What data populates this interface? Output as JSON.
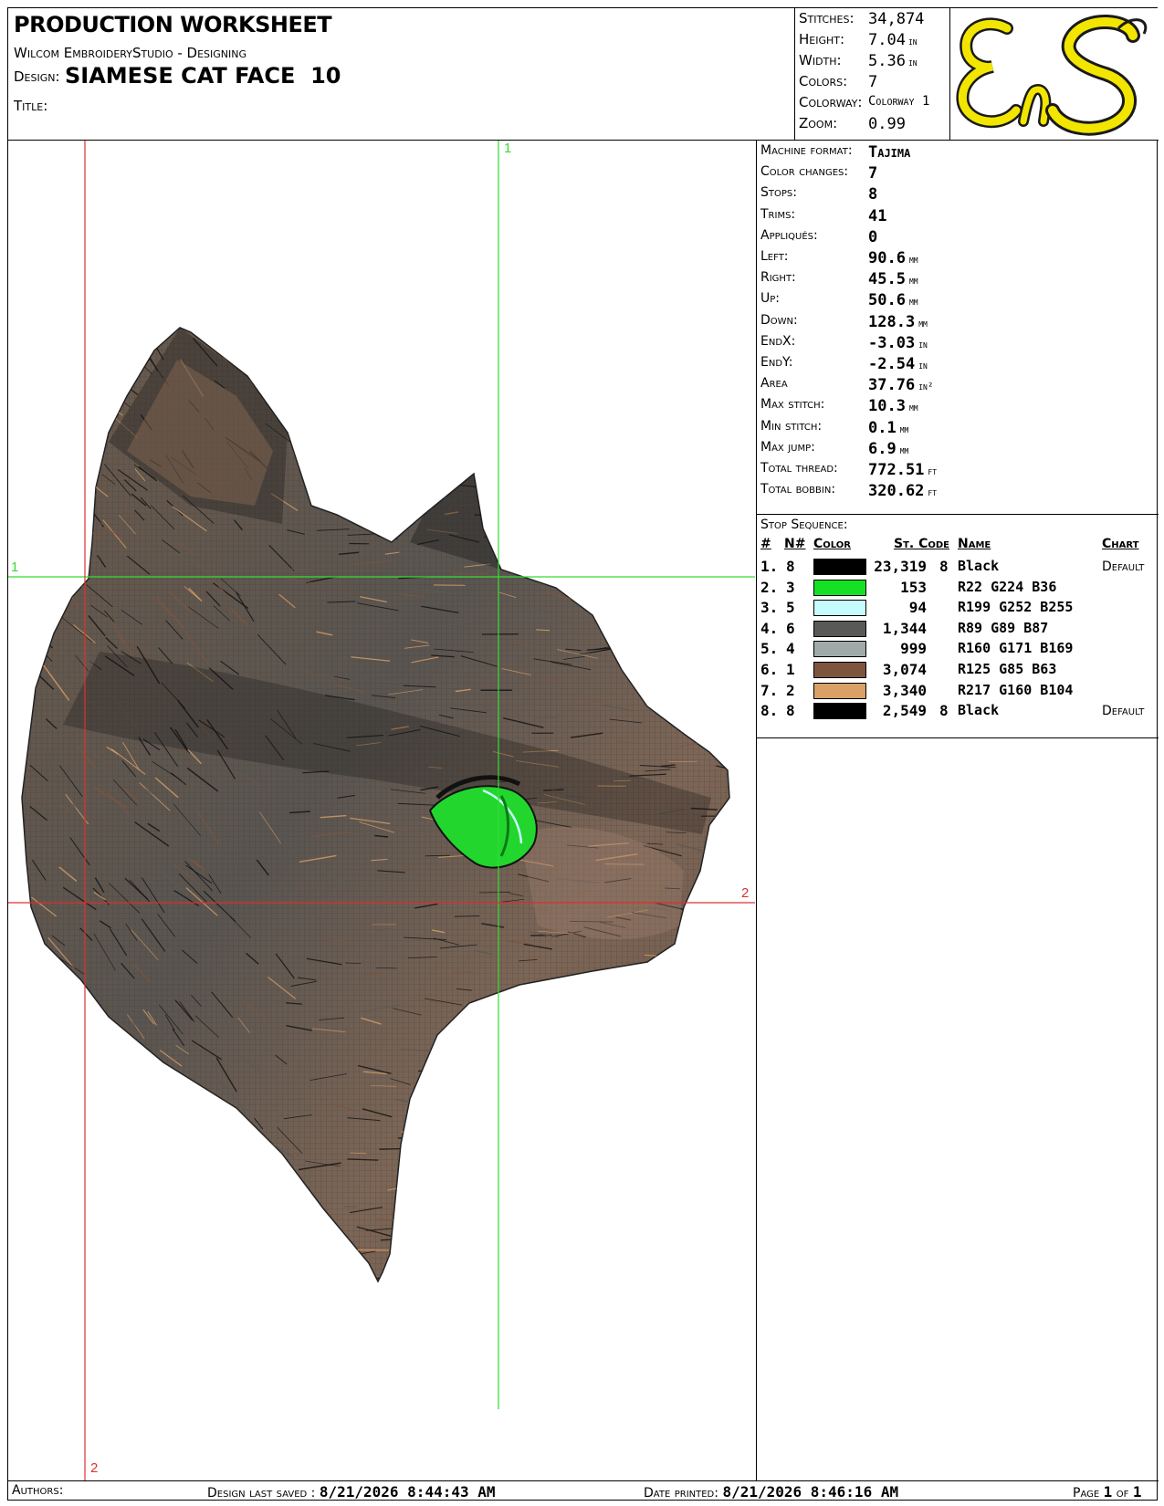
{
  "header": {
    "title": "PRODUCTION WORKSHEET",
    "software": "Wilcom EmbroideryStudio - Designing",
    "design_label": "Design:",
    "design_name": "SIAMESE CAT FACE  10",
    "title_label": "Title:"
  },
  "summary": [
    {
      "label": "Stitches:",
      "value": "34,874",
      "unit": ""
    },
    {
      "label": "Height:",
      "value": "7.04",
      "unit": "in"
    },
    {
      "label": "Width:",
      "value": "5.36",
      "unit": "in"
    },
    {
      "label": "Colors:",
      "value": "7",
      "unit": ""
    },
    {
      "label": "Colorway:",
      "value": "Colorway 1",
      "unit": ""
    },
    {
      "label": "Zoom:",
      "value": "0.99",
      "unit": ""
    }
  ],
  "logo": {
    "text": "EnS",
    "fill": "#f2e600",
    "stroke": "#1a1a1a"
  },
  "stats": [
    {
      "label": "Machine format:",
      "value": "Tajima",
      "unit": ""
    },
    {
      "label": "Color changes:",
      "value": "7",
      "unit": ""
    },
    {
      "label": "Stops:",
      "value": "8",
      "unit": ""
    },
    {
      "label": "Trims:",
      "value": "41",
      "unit": ""
    },
    {
      "label": "Appliqués:",
      "value": "0",
      "unit": ""
    },
    {
      "label": "Left:",
      "value": "90.6",
      "unit": "mm"
    },
    {
      "label": "Right:",
      "value": "45.5",
      "unit": "mm"
    },
    {
      "label": "Up:",
      "value": "50.6",
      "unit": "mm"
    },
    {
      "label": "Down:",
      "value": "128.3",
      "unit": "mm"
    },
    {
      "label": "EndX:",
      "value": "-3.03",
      "unit": "in"
    },
    {
      "label": "EndY:",
      "value": "-2.54",
      "unit": "in"
    },
    {
      "label": "Area",
      "value": "37.76",
      "unit": "in²"
    },
    {
      "label": "Max stitch:",
      "value": "10.3",
      "unit": "mm"
    },
    {
      "label": "Min stitch:",
      "value": "0.1",
      "unit": "mm"
    },
    {
      "label": "Max jump:",
      "value": "6.9",
      "unit": "mm"
    },
    {
      "label": "Total thread:",
      "value": "772.51",
      "unit": "ft"
    },
    {
      "label": "Total bobbin:",
      "value": "320.62",
      "unit": "ft"
    }
  ],
  "stop_sequence": {
    "title": "Stop Sequence:",
    "headers": {
      "num": "#",
      "needle": "N#",
      "color": "Color",
      "stitches_code": "St. Code",
      "name": "Name",
      "chart": "Chart"
    },
    "rows": [
      {
        "num": "1.",
        "needle": "8",
        "color": "#000000",
        "stitches": "23,319",
        "code": "8",
        "name": "Black",
        "chart": "Default"
      },
      {
        "num": "2.",
        "needle": "3",
        "color": "#16e024",
        "stitches": "153",
        "code": "",
        "name": "R22 G224 B36",
        "chart": ""
      },
      {
        "num": "3.",
        "needle": "5",
        "color": "#c7fcff",
        "stitches": "94",
        "code": "",
        "name": "R199 G252 B255",
        "chart": ""
      },
      {
        "num": "4.",
        "needle": "6",
        "color": "#595957",
        "stitches": "1,344",
        "code": "",
        "name": "R89 G89 B87",
        "chart": ""
      },
      {
        "num": "5.",
        "needle": "4",
        "color": "#a0aba9",
        "stitches": "999",
        "code": "",
        "name": "R160 G171 B169",
        "chart": ""
      },
      {
        "num": "6.",
        "needle": "1",
        "color": "#7d553f",
        "stitches": "3,074",
        "code": "",
        "name": "R125 G85 B63",
        "chart": ""
      },
      {
        "num": "7.",
        "needle": "2",
        "color": "#d9a068",
        "stitches": "3,340",
        "code": "",
        "name": "R217 G160 B104",
        "chart": ""
      },
      {
        "num": "8.",
        "needle": "8",
        "color": "#000000",
        "stitches": "2,549",
        "code": "8",
        "name": "Black",
        "chart": "Default"
      }
    ]
  },
  "canvas": {
    "guide_green_label_v": "1",
    "guide_green_label_h": "1",
    "guide_red_label_h": "2",
    "guide_red_label_v": "2",
    "green_color": "#33dd33",
    "red_color": "#e03030"
  },
  "footer": {
    "authors_label": "Authors:",
    "saved_label": "Design last saved :",
    "saved_value": "8/21/2026 8:44:43 AM",
    "printed_label": "Date printed:",
    "printed_value": "8/21/2026 8:46:16 AM",
    "page_label": "Page",
    "page_num": "1",
    "page_of": "of",
    "page_total": "1"
  }
}
